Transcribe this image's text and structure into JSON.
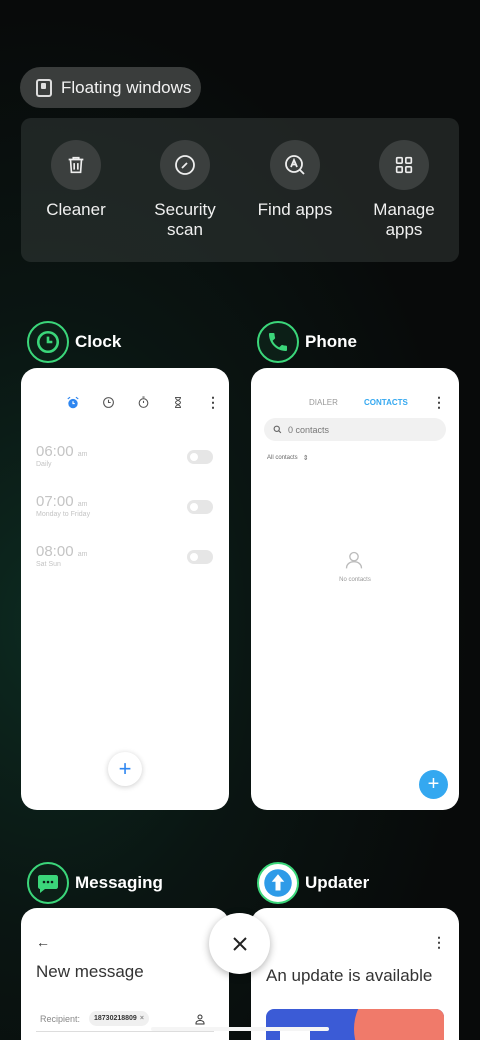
{
  "floating_windows": {
    "label": "Floating windows",
    "icon": "floating-window-icon"
  },
  "quick_actions": [
    {
      "label": "Cleaner",
      "icon": "trash-icon"
    },
    {
      "label": "Security\nscan",
      "icon": "security-scan-icon"
    },
    {
      "label": "Find apps",
      "icon": "find-apps-icon"
    },
    {
      "label": "Manage\napps",
      "icon": "grid-icon"
    }
  ],
  "apps": {
    "clock": {
      "name": "Clock",
      "alarms": [
        {
          "time": "06:00",
          "ampm": "am",
          "repeat": "Daily"
        },
        {
          "time": "07:00",
          "ampm": "am",
          "repeat": "Monday to Friday"
        },
        {
          "time": "08:00",
          "ampm": "am",
          "repeat": "Sat Sun"
        }
      ],
      "fab": "+"
    },
    "phone": {
      "name": "Phone",
      "tabs": [
        "DIALER",
        "CONTACTS"
      ],
      "active_tab": "CONTACTS",
      "search_placeholder": "0 contacts",
      "filter": "All contacts",
      "empty_text": "No contacts",
      "fab": "+"
    },
    "messaging": {
      "name": "Messaging",
      "title": "New message",
      "recipient_label": "Recipient:",
      "recipient_chip": "18730218809"
    },
    "updater": {
      "name": "Updater",
      "title": "An update is available"
    }
  },
  "colors": {
    "accent_green": "#3bd67a",
    "accent_blue": "#34a8f0",
    "clock_blue": "#2e86f0"
  }
}
